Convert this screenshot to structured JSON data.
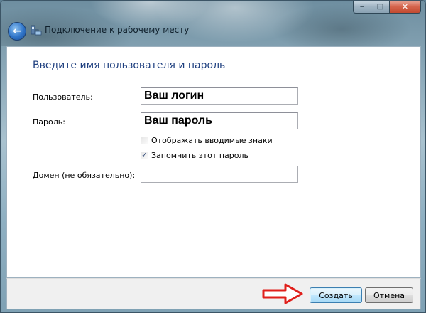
{
  "window": {
    "nav_title": "Подключение к рабочему месту",
    "caption": {
      "minimize_glyph": "‒",
      "maximize_glyph": "□",
      "close_glyph": "✕"
    },
    "back_glyph": "←"
  },
  "form": {
    "heading": "Введите имя пользователя и пароль",
    "username": {
      "label": "Пользователь:",
      "value": "Ваш логин"
    },
    "password": {
      "label": "Пароль:",
      "value": "Ваш пароль"
    },
    "show_chars": {
      "label": "Отображать вводимые знаки",
      "checked": false,
      "mark": ""
    },
    "remember": {
      "label": "Запомнить этот пароль",
      "checked": true,
      "mark": "✓"
    },
    "domain": {
      "label": "Домен (не обязательно):",
      "value": ""
    }
  },
  "footer": {
    "create_label": "Создать",
    "cancel_label": "Отмена"
  },
  "icons": {
    "back": "back-arrow-icon",
    "network": "network-connection-icon",
    "annotation": "red-arrow-icon"
  },
  "colors": {
    "heading": "#1e3f7f",
    "annotation_arrow": "#e0201b",
    "default_button_border": "#3c7fb1"
  }
}
